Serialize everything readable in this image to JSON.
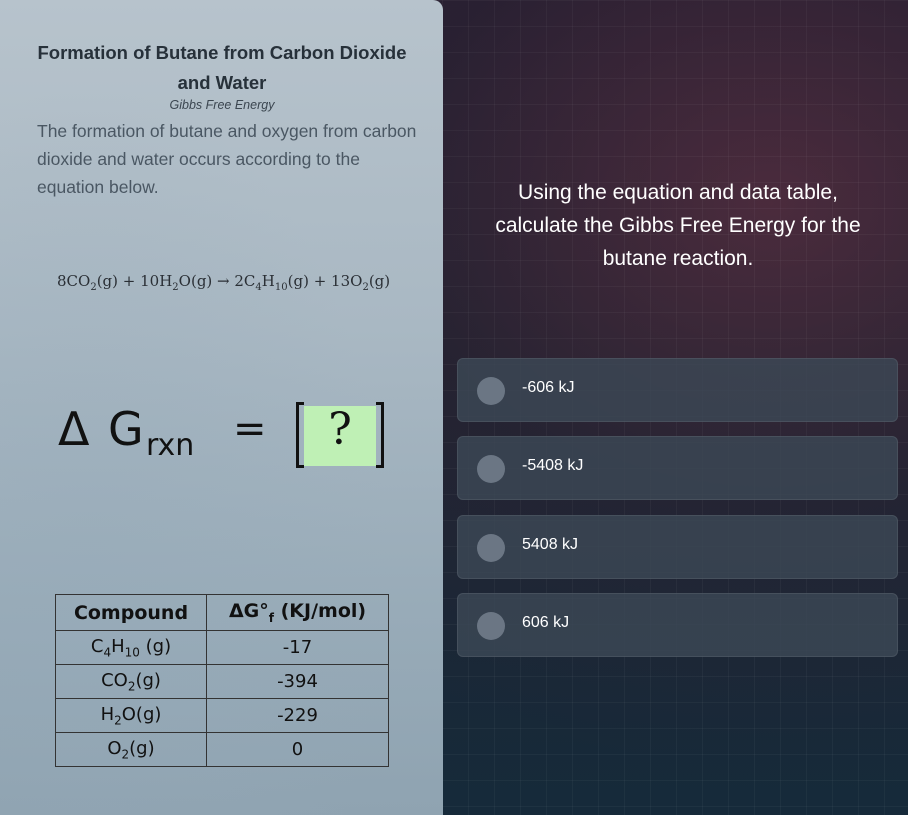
{
  "left_panel": {
    "title": "Formation of Butane from Carbon Dioxide and Water",
    "subtitle": "Gibbs Free Energy",
    "intro": "The formation of butane and oxygen from carbon dioxide and water occurs according to the equation below.",
    "equation": {
      "r1_coef": "8CO",
      "r1_sub": "2",
      "r1_state": "(g)",
      "plus1": " + ",
      "r2_coef": "10H",
      "r2_sub": "2",
      "r2_rest": "O(g)",
      "arrow": " → ",
      "p1_coef": "2C",
      "p1_sub1": "4",
      "p1_mid": "H",
      "p1_sub2": "10",
      "p1_state": "(g)",
      "plus2": " + ",
      "p2_coef": "13O",
      "p2_sub": "2",
      "p2_state": "(g)"
    },
    "gibbs": {
      "delta": "Δ",
      "g": "G",
      "subscript": "rxn",
      "equals": "=",
      "unknown": "?"
    },
    "table": {
      "headers": [
        "Compound",
        "ΔG°"
      ],
      "header_sub": "f",
      "header_unit": " (KJ/mol)",
      "rows": [
        {
          "formula_parts": [
            "C",
            "4",
            "H",
            "10",
            " (g)"
          ],
          "value": "-17"
        },
        {
          "formula_parts": [
            "CO",
            "2",
            "(g)"
          ],
          "value": "-394"
        },
        {
          "formula_parts": [
            "H",
            "2",
            "O(g)"
          ],
          "value": "-229"
        },
        {
          "formula_parts": [
            "O",
            "2",
            "(g)"
          ],
          "value": "0"
        }
      ]
    }
  },
  "question": "Using the equation and data table, calculate the Gibbs Free Energy for the butane reaction.",
  "options": [
    {
      "label": "-606 kJ"
    },
    {
      "label": "-5408 kJ"
    },
    {
      "label": "5408 kJ"
    },
    {
      "label": "606 kJ"
    }
  ],
  "colors": {
    "answer_box": "#bff0b5",
    "option_bg": "#3c4856",
    "radio": "#6b7684"
  }
}
